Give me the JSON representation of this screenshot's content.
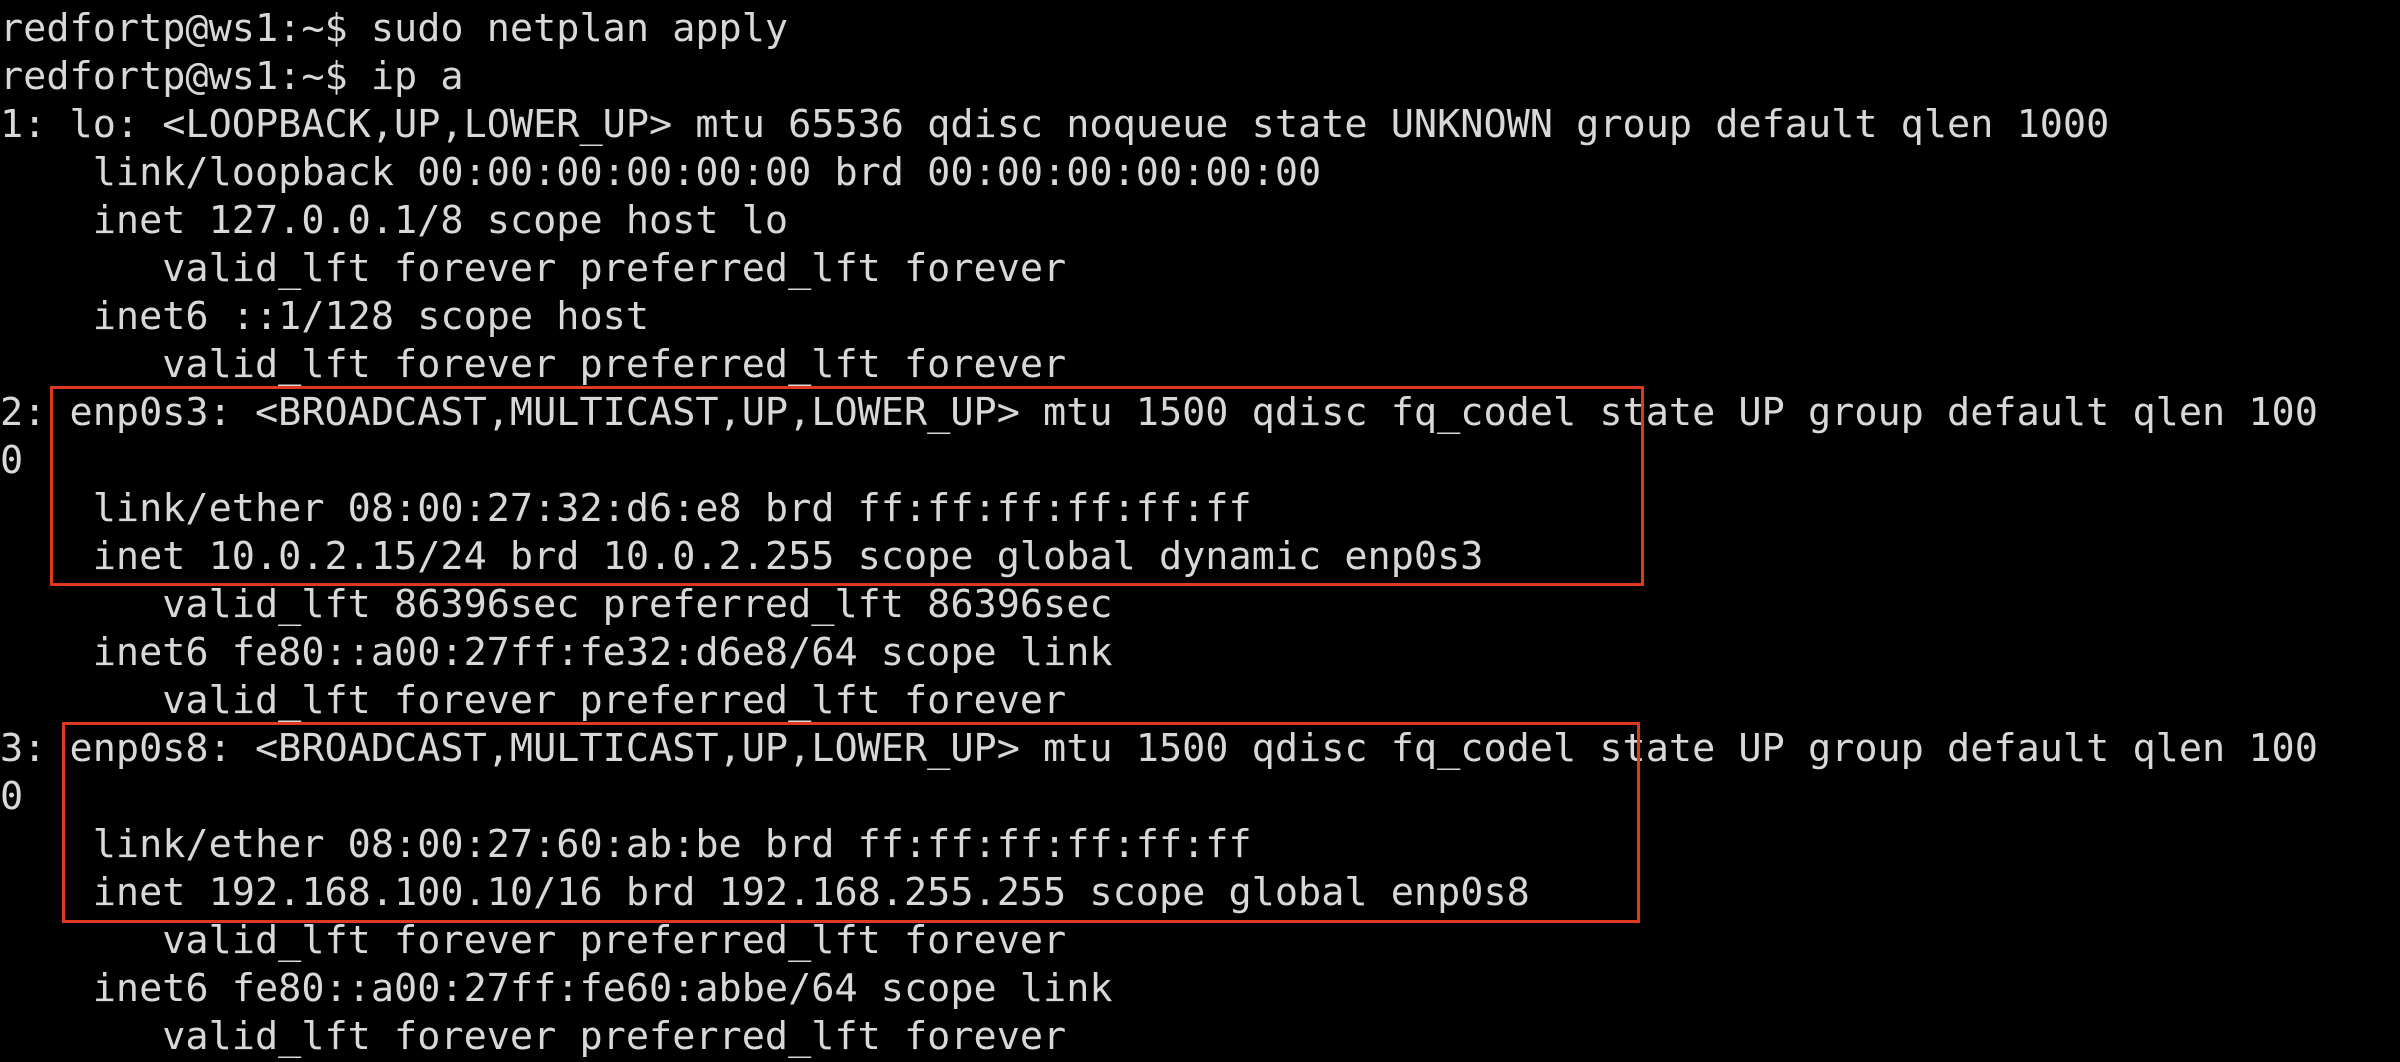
{
  "terminal": {
    "lines": [
      "redfortp@ws1:~$ sudo netplan apply",
      "redfortp@ws1:~$ ip a",
      "1: lo: <LOOPBACK,UP,LOWER_UP> mtu 65536 qdisc noqueue state UNKNOWN group default qlen 1000",
      "    link/loopback 00:00:00:00:00:00 brd 00:00:00:00:00:00",
      "    inet 127.0.0.1/8 scope host lo",
      "       valid_lft forever preferred_lft forever",
      "    inet6 ::1/128 scope host",
      "       valid_lft forever preferred_lft forever",
      "2: enp0s3: <BROADCAST,MULTICAST,UP,LOWER_UP> mtu 1500 qdisc fq_codel state UP group default qlen 100",
      "0",
      "    link/ether 08:00:27:32:d6:e8 brd ff:ff:ff:ff:ff:ff",
      "    inet 10.0.2.15/24 brd 10.0.2.255 scope global dynamic enp0s3",
      "       valid_lft 86396sec preferred_lft 86396sec",
      "    inet6 fe80::a00:27ff:fe32:d6e8/64 scope link",
      "       valid_lft forever preferred_lft forever",
      "3: enp0s8: <BROADCAST,MULTICAST,UP,LOWER_UP> mtu 1500 qdisc fq_codel state UP group default qlen 100",
      "0",
      "    link/ether 08:00:27:60:ab:be brd ff:ff:ff:ff:ff:ff",
      "    inet 192.168.100.10/16 brd 192.168.255.255 scope global enp0s8",
      "       valid_lft forever preferred_lft forever",
      "    inet6 fe80::a00:27ff:fe60:abbe/64 scope link",
      "       valid_lft forever preferred_lft forever"
    ]
  },
  "colors": {
    "background": "#000000",
    "text": "#d8d8d8",
    "highlight": "#e03a1e"
  }
}
